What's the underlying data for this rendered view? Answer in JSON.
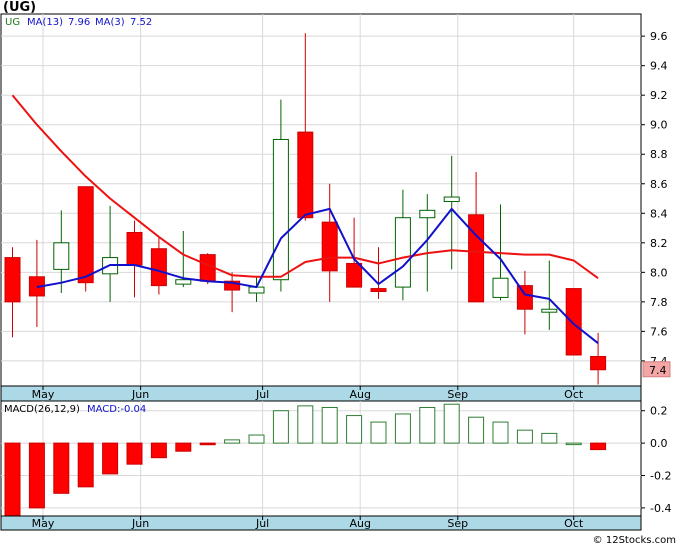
{
  "title": "(UG)",
  "chart_data": [
    {
      "type": "candlestick",
      "legend": {
        "symbol": "UG",
        "ma_long_label": "MA(13)",
        "ma_long_value": "7.96",
        "ma_short_label": "MA(3)",
        "ma_short_value": "7.52"
      },
      "x_tick_labels": [
        "May",
        "Jun",
        "Jul",
        "Aug",
        "Sep",
        "Oct"
      ],
      "x_tick_positions": [
        1.25,
        5.25,
        10.25,
        14.25,
        18.25,
        23.0
      ],
      "y_ticks": [
        "7.4",
        "7.6",
        "7.8",
        "8.0",
        "8.2",
        "8.4",
        "8.6",
        "8.8",
        "9.0",
        "9.2",
        "9.4",
        "9.6"
      ],
      "ylim": [
        7.23,
        9.75
      ],
      "last_price_label": "7.4",
      "candles": [
        {
          "o": 8.1,
          "h": 8.17,
          "l": 7.56,
          "c": 7.8
        },
        {
          "o": 7.97,
          "h": 8.22,
          "l": 7.63,
          "c": 7.84
        },
        {
          "o": 8.02,
          "h": 8.42,
          "l": 7.86,
          "c": 8.2
        },
        {
          "o": 8.58,
          "h": 8.58,
          "l": 7.87,
          "c": 7.93
        },
        {
          "o": 7.99,
          "h": 8.45,
          "l": 7.8,
          "c": 8.1
        },
        {
          "o": 8.27,
          "h": 8.35,
          "l": 7.83,
          "c": 8.05
        },
        {
          "o": 8.16,
          "h": 8.24,
          "l": 7.85,
          "c": 7.91
        },
        {
          "o": 7.92,
          "h": 8.28,
          "l": 7.9,
          "c": 7.95
        },
        {
          "o": 8.12,
          "h": 8.13,
          "l": 7.92,
          "c": 7.94
        },
        {
          "o": 7.94,
          "h": 8.0,
          "l": 7.73,
          "c": 7.88
        },
        {
          "o": 7.86,
          "h": 7.97,
          "l": 7.8,
          "c": 7.9
        },
        {
          "o": 7.95,
          "h": 9.17,
          "l": 7.87,
          "c": 8.9
        },
        {
          "o": 8.95,
          "h": 9.62,
          "l": 8.35,
          "c": 8.37
        },
        {
          "o": 8.34,
          "h": 8.6,
          "l": 7.8,
          "c": 8.01
        },
        {
          "o": 8.06,
          "h": 8.37,
          "l": 7.91,
          "c": 7.9
        },
        {
          "o": 7.89,
          "h": 8.17,
          "l": 7.82,
          "c": 7.87
        },
        {
          "o": 7.9,
          "h": 8.56,
          "l": 7.81,
          "c": 8.37
        },
        {
          "o": 8.37,
          "h": 8.53,
          "l": 7.87,
          "c": 8.42
        },
        {
          "o": 8.48,
          "h": 8.79,
          "l": 8.02,
          "c": 8.51
        },
        {
          "o": 8.39,
          "h": 8.68,
          "l": 7.8,
          "c": 7.8
        },
        {
          "o": 7.83,
          "h": 8.46,
          "l": 7.81,
          "c": 7.96
        },
        {
          "o": 7.91,
          "h": 8.01,
          "l": 7.58,
          "c": 7.75
        },
        {
          "o": 7.73,
          "h": 8.08,
          "l": 7.61,
          "c": 7.75
        },
        {
          "o": 7.89,
          "h": 7.89,
          "l": 7.44,
          "c": 7.44
        },
        {
          "o": 7.43,
          "h": 7.59,
          "l": 7.24,
          "c": 7.34
        }
      ],
      "ma13": [
        9.2,
        9.0,
        8.82,
        8.65,
        8.5,
        8.37,
        8.24,
        8.12,
        8.05,
        7.98,
        7.97,
        7.97,
        8.07,
        8.1,
        8.1,
        8.06,
        8.1,
        8.13,
        8.15,
        8.14,
        8.13,
        8.12,
        8.12,
        8.08,
        7.96
      ],
      "ma3": [
        null,
        7.9,
        7.93,
        7.97,
        8.05,
        8.05,
        8.01,
        7.96,
        7.94,
        7.93,
        7.9,
        8.23,
        8.39,
        8.43,
        8.09,
        7.92,
        8.04,
        8.22,
        8.43,
        8.25,
        8.09,
        7.85,
        7.82,
        7.65,
        7.52
      ]
    },
    {
      "type": "bar",
      "legend": {
        "label": "MACD(26,12,9)",
        "value_label": "MACD:-0.04"
      },
      "y_ticks": [
        "-0.4",
        "-0.2",
        "0.0",
        "0.2"
      ],
      "ylim": [
        -0.45,
        0.26
      ],
      "values": [
        -0.45,
        -0.4,
        -0.31,
        -0.27,
        -0.19,
        -0.13,
        -0.09,
        -0.05,
        -0.01,
        0.02,
        0.05,
        0.2,
        0.23,
        0.22,
        0.17,
        0.13,
        0.18,
        0.22,
        0.24,
        0.16,
        0.13,
        0.08,
        0.06,
        0.0,
        -0.04
      ]
    }
  ],
  "watermark": "© 12Stocks.com",
  "colors": {
    "up_fill": "#ffffff",
    "up_edge": "#006400",
    "down_fill": "#ff0000",
    "down_edge": "#cc0000",
    "ma13": "#ee1111",
    "ma3": "#1111cc",
    "axis_band": "#add8e6",
    "last_price_bg": "#f4a6a6",
    "macd_edge": "#2e7d32"
  }
}
